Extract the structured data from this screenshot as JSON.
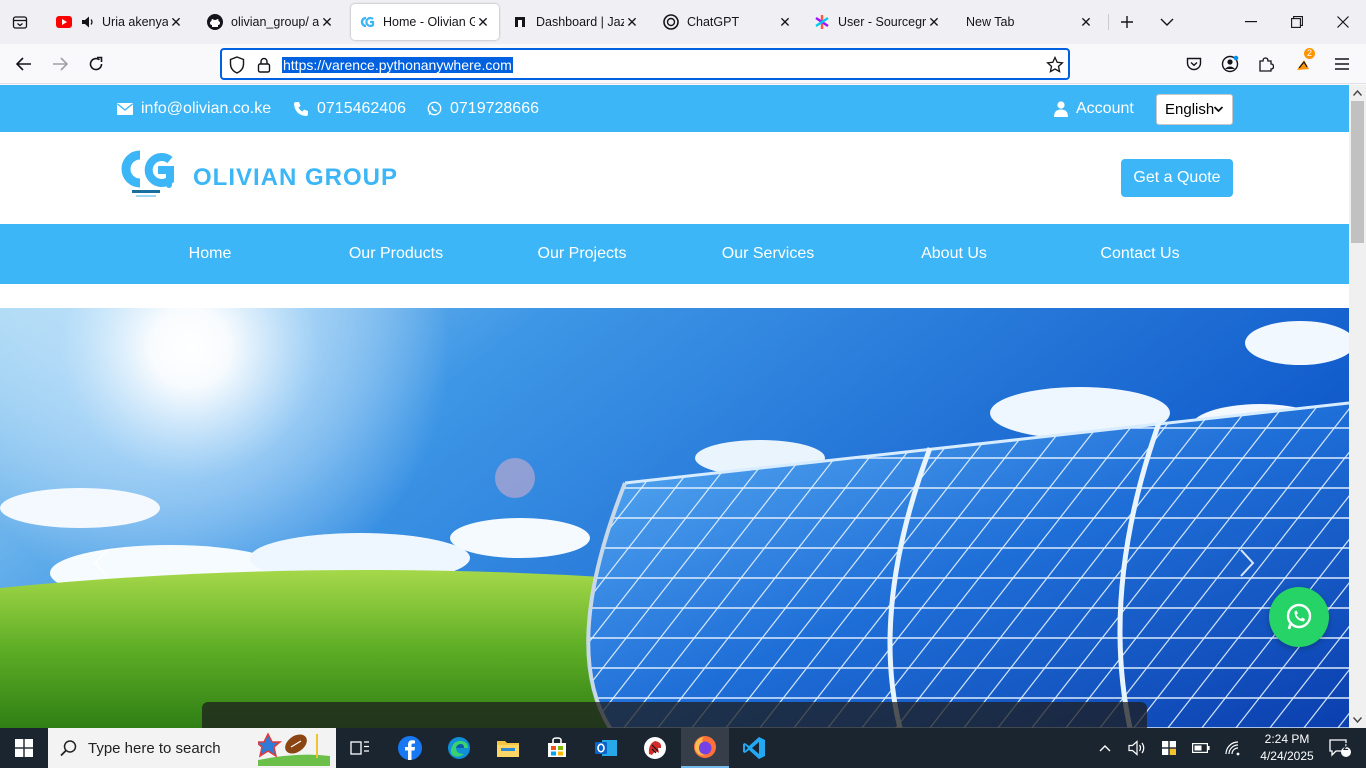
{
  "browser": {
    "tabs": [
      {
        "label": "Uria akenya n",
        "favicon": "youtube-icon",
        "audio": true
      },
      {
        "label": "olivian_group/ at",
        "favicon": "github-icon"
      },
      {
        "label": "Home - Olivian Gr",
        "favicon": "olivian-favicon",
        "active": true
      },
      {
        "label": "Dashboard | Jazm",
        "favicon": "dashboard-favicon"
      },
      {
        "label": "ChatGPT",
        "favicon": "chatgpt-icon"
      },
      {
        "label": "User - Sourcegrap",
        "favicon": "sourcegraph-icon"
      },
      {
        "label": "New Tab",
        "favicon": ""
      }
    ],
    "url": "https://varence.pythonanywhere.com",
    "extensions_badge": "2"
  },
  "site": {
    "topbar": {
      "email": "info@olivian.co.ke",
      "phone": "0715462406",
      "whatsapp": "0719728666",
      "account_label": "Account",
      "language": "English"
    },
    "header": {
      "brand": "OLIVIAN GROUP",
      "quote_label": "Get a Quote"
    },
    "nav": [
      "Home",
      "Our Products",
      "Our Projects",
      "Our Services",
      "About Us",
      "Contact Us"
    ],
    "colors": {
      "primary": "#3cb6f6",
      "whatsapp": "#25d366"
    }
  },
  "taskbar": {
    "search_placeholder": "Type here to search",
    "time": "2:24 PM",
    "date": "4/24/2025",
    "notification_count": "2"
  }
}
